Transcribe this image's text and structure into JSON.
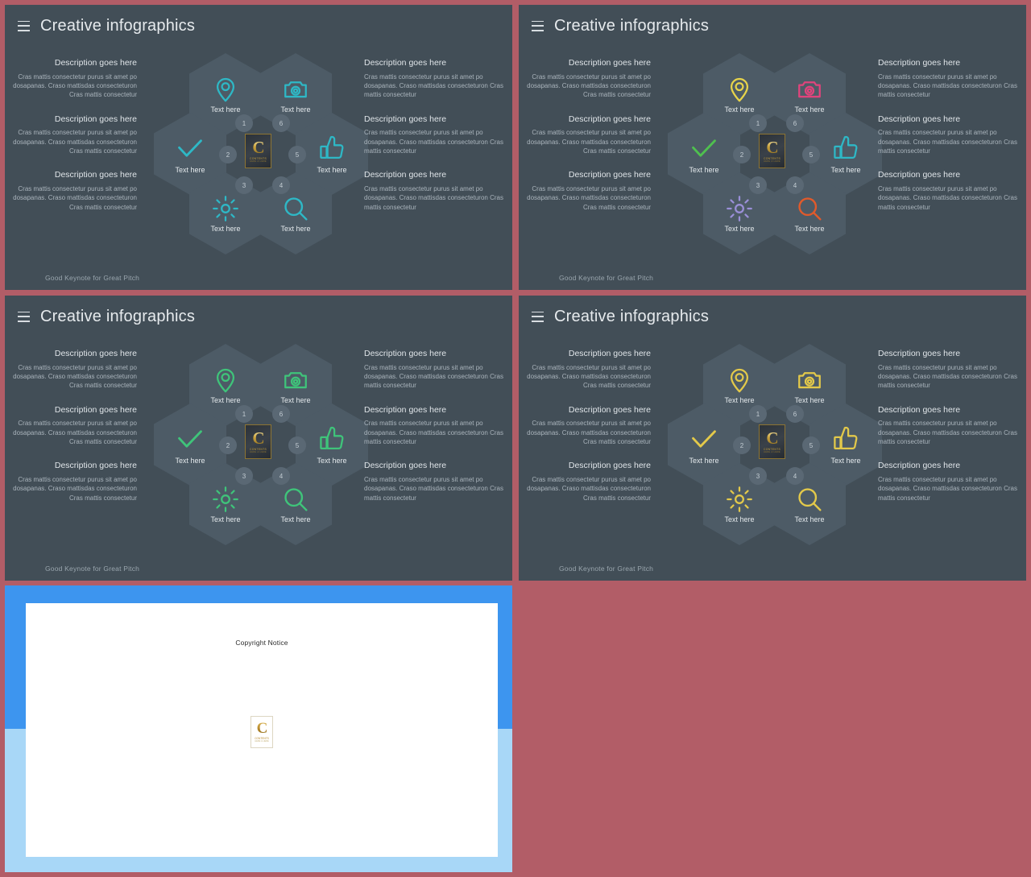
{
  "canvas": {
    "bg_color": "#b25d67",
    "panel_bg": "#424e57",
    "hex_fill": "#4d5b66"
  },
  "slides": [
    {
      "id": "slide-1",
      "title": "Creative infographics",
      "menu_icon": "hamburger-icon",
      "footer": "Good Keynote for Great Pitch",
      "icon_palette": "teal-monochrome",
      "hexes": [
        {
          "pos": "top-left",
          "icon": "location-pin-icon",
          "label": "Text here",
          "color": "#2eb8c6",
          "number": "1"
        },
        {
          "pos": "top-right",
          "icon": "camera-icon",
          "label": "Text here",
          "color": "#2eb8c6",
          "number": "6"
        },
        {
          "pos": "middle-left",
          "icon": "check-icon",
          "label": "Text here",
          "color": "#2eb8c6",
          "number": "2"
        },
        {
          "pos": "middle-right",
          "icon": "thumbs-up-icon",
          "label": "Text here",
          "color": "#2eb8c6",
          "number": "5"
        },
        {
          "pos": "bottom-left",
          "icon": "gear-icon",
          "label": "Text here",
          "color": "#2eb8c6",
          "number": "3"
        },
        {
          "pos": "bottom-right",
          "icon": "search-icon",
          "label": "Text here",
          "color": "#2eb8c6",
          "number": "4"
        }
      ]
    },
    {
      "id": "slide-2",
      "title": "Creative infographics",
      "menu_icon": "hamburger-icon",
      "footer": "Good Keynote for Great Pitch",
      "icon_palette": "multicolor",
      "hexes": [
        {
          "pos": "top-left",
          "icon": "location-pin-icon",
          "label": "Text here",
          "color": "#e8d44a",
          "number": "1"
        },
        {
          "pos": "top-right",
          "icon": "camera-icon",
          "label": "Text here",
          "color": "#e0447c",
          "number": "6"
        },
        {
          "pos": "middle-left",
          "icon": "check-icon",
          "label": "Text here",
          "color": "#4fc04f",
          "number": "2"
        },
        {
          "pos": "middle-right",
          "icon": "thumbs-up-icon",
          "label": "Text here",
          "color": "#2eb8c6",
          "number": "5"
        },
        {
          "pos": "bottom-left",
          "icon": "gear-icon",
          "label": "Text here",
          "color": "#9a8fd8",
          "number": "3"
        },
        {
          "pos": "bottom-right",
          "icon": "search-icon",
          "label": "Text here",
          "color": "#e05a2b",
          "number": "4"
        }
      ]
    },
    {
      "id": "slide-3",
      "title": "Creative infographics",
      "menu_icon": "hamburger-icon",
      "footer": "Good Keynote for Great Pitch",
      "icon_palette": "green-monochrome",
      "hexes": [
        {
          "pos": "top-left",
          "icon": "location-pin-icon",
          "label": "Text here",
          "color": "#3fc47a",
          "number": "1"
        },
        {
          "pos": "top-right",
          "icon": "camera-icon",
          "label": "Text here",
          "color": "#3fc47a",
          "number": "6"
        },
        {
          "pos": "middle-left",
          "icon": "check-icon",
          "label": "Text here",
          "color": "#3fc47a",
          "number": "2"
        },
        {
          "pos": "middle-right",
          "icon": "thumbs-up-icon",
          "label": "Text here",
          "color": "#3fc47a",
          "number": "5"
        },
        {
          "pos": "bottom-left",
          "icon": "gear-icon",
          "label": "Text here",
          "color": "#3fc47a",
          "number": "3"
        },
        {
          "pos": "bottom-right",
          "icon": "search-icon",
          "label": "Text here",
          "color": "#3fc47a",
          "number": "4"
        }
      ]
    },
    {
      "id": "slide-4",
      "title": "Creative infographics",
      "menu_icon": "hamburger-icon",
      "footer": "Good Keynote for Great Pitch",
      "icon_palette": "gold-monochrome",
      "hexes": [
        {
          "pos": "top-left",
          "icon": "location-pin-icon",
          "label": "Text here",
          "color": "#e3c94a",
          "number": "1"
        },
        {
          "pos": "top-right",
          "icon": "camera-icon",
          "label": "Text here",
          "color": "#e3c94a",
          "number": "6"
        },
        {
          "pos": "middle-left",
          "icon": "check-icon",
          "label": "Text here",
          "color": "#e3c94a",
          "number": "2"
        },
        {
          "pos": "middle-right",
          "icon": "thumbs-up-icon",
          "label": "Text here",
          "color": "#e3c94a",
          "number": "5"
        },
        {
          "pos": "bottom-left",
          "icon": "gear-icon",
          "label": "Text here",
          "color": "#e3c94a",
          "number": "3"
        },
        {
          "pos": "bottom-right",
          "icon": "search-icon",
          "label": "Text here",
          "color": "#e3c94a",
          "number": "4"
        }
      ]
    }
  ],
  "description": {
    "title": "Description goes here",
    "body": "Cras mattis consectetur purus sit amet po dosapanas. Craso mattisdas consecteturon Cras mattis consectetur"
  },
  "center_logo": {
    "letter": "C",
    "line1": "CONTENTS",
    "line2": "HERE & HERE"
  },
  "copyright_panel": {
    "notice": "Copyright Notice",
    "band_top_color": "#3d95ef",
    "band_bottom_color": "#a8d7f7",
    "logo": {
      "letter": "C",
      "line1": "CONTENTS",
      "line2": "HERE & HERE"
    }
  }
}
